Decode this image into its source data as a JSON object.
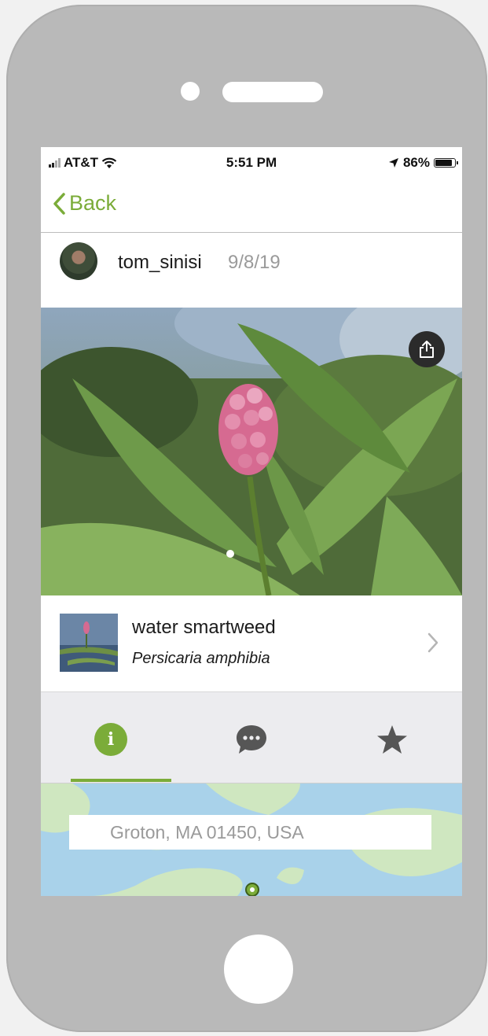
{
  "status_bar": {
    "carrier": "AT&T",
    "time": "5:51 PM",
    "battery": "86%",
    "battery_level": 0.86,
    "icons": [
      "signal-icon",
      "wifi-icon",
      "location-arrow-icon",
      "battery-icon"
    ]
  },
  "nav": {
    "back_label": "Back",
    "accent_color": "#7bac39"
  },
  "observation": {
    "username": "tom_sinisi",
    "date": "9/8/19"
  },
  "photo": {
    "icons": [
      "share-icon"
    ],
    "page_indicator_count": 1
  },
  "species": {
    "common_name": "water smartweed",
    "scientific_name": "Persicaria amphibia",
    "icons": [
      "chevron-right-icon"
    ]
  },
  "tabs": [
    {
      "name": "info",
      "icon": "info-icon",
      "active": true
    },
    {
      "name": "comments",
      "icon": "speech-bubble-icon",
      "active": false
    },
    {
      "name": "favorite",
      "icon": "star-icon",
      "active": false
    }
  ],
  "map": {
    "location": "Groton, MA 01450, USA",
    "icons": [
      "map-pin-icon"
    ]
  }
}
